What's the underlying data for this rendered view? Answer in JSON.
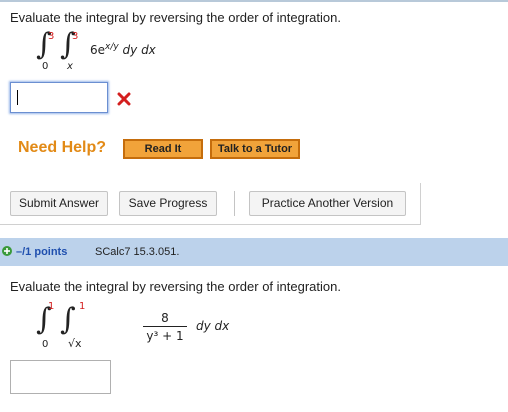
{
  "question1": {
    "prompt": "Evaluate the integral by reversing the order of integration.",
    "outer_lower": "0",
    "outer_upper": "3",
    "inner_lower": "x",
    "inner_upper": "3",
    "integrand_coeff": "6e",
    "integrand_exp": "x/y",
    "integrand_diff": " dy dx",
    "answer_value": "",
    "status_icon": "x-mark-icon"
  },
  "help": {
    "label": "Need Help?",
    "read_it": "Read It",
    "tutor": "Talk to a Tutor"
  },
  "actions": {
    "submit": "Submit Answer",
    "save": "Save Progress",
    "practice": "Practice Another Version"
  },
  "question2": {
    "points": "–/1 points",
    "source": "SCalc7 15.3.051.",
    "prompt": "Evaluate the integral by reversing the order of integration.",
    "outer_lower": "0",
    "outer_upper": "1",
    "inner_lower": "√x",
    "inner_upper": "1",
    "numerator": "8",
    "denominator": "y³ + 1",
    "integrand_diff": "dy dx",
    "answer_value": ""
  },
  "colors": {
    "accent_red": "#d41f1f",
    "header_bar": "#bcd2eb",
    "help_orange": "#e28a16",
    "button_orange": "#f1a33a",
    "points_blue": "#1f4fae"
  }
}
